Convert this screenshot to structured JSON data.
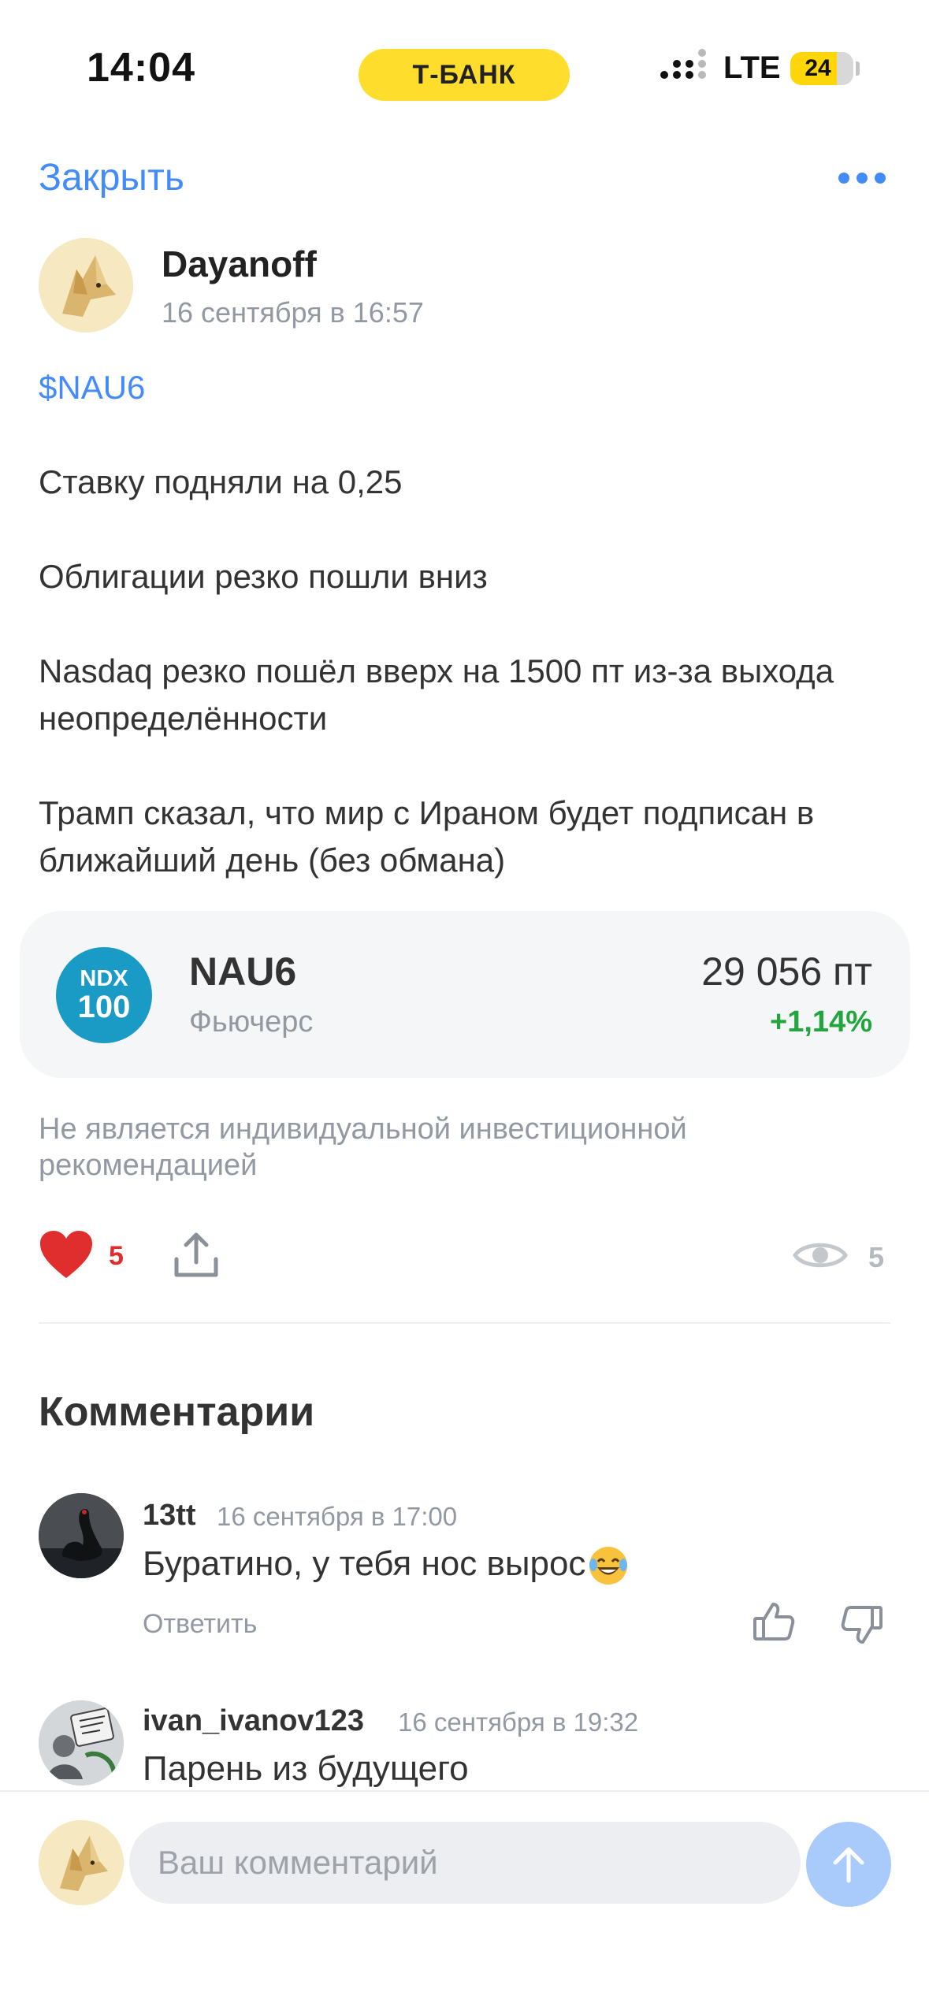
{
  "status_bar": {
    "time": "14:04",
    "carrier_badge": "Т-БАНК",
    "network": "LTE",
    "battery": "24",
    "battery_level": 0.24
  },
  "header": {
    "close_label": "Закрыть",
    "more_icon": "more-dots-icon"
  },
  "post": {
    "author": "Dayanoff",
    "date": "16 сентября в 16:57",
    "ticker": "$NAU6",
    "paragraphs": [
      "Ставку подняли на 0,25",
      "Облигации резко пошли вниз",
      "Nasdaq резко пошёл вверх на 1500 пт из-за выхода неопределённости",
      "Трамп сказал, что мир с Ираном будет подписан в ближайший день (без обмана)"
    ],
    "instrument": {
      "logo_line1": "NDX",
      "logo_line2": "100",
      "name": "NAU6",
      "type": "Фьючерс",
      "price": "29 056 пт",
      "change": "+1,14%"
    },
    "disclaimer": "Не является индивидуальной инвестиционной рекомендацией",
    "likes": "5",
    "views": "5"
  },
  "comments": {
    "title": "Комментарии",
    "items": [
      {
        "author": "13tt",
        "date": "16 сентября в 17:00",
        "text": "Буратино, у тебя нос вырос",
        "reply_label": "Ответить"
      },
      {
        "author": "ivan_ivanov123",
        "date": "16 сентября в 19:32",
        "text": "Парень из будущего"
      }
    ]
  },
  "composer": {
    "placeholder": "Ваш комментарий"
  },
  "colors": {
    "accent": "#428bf9",
    "brand_yellow": "#ffdd2d",
    "like_red": "#e02d2d",
    "positive_green": "#22a53d",
    "muted_text": "#9299a2"
  }
}
